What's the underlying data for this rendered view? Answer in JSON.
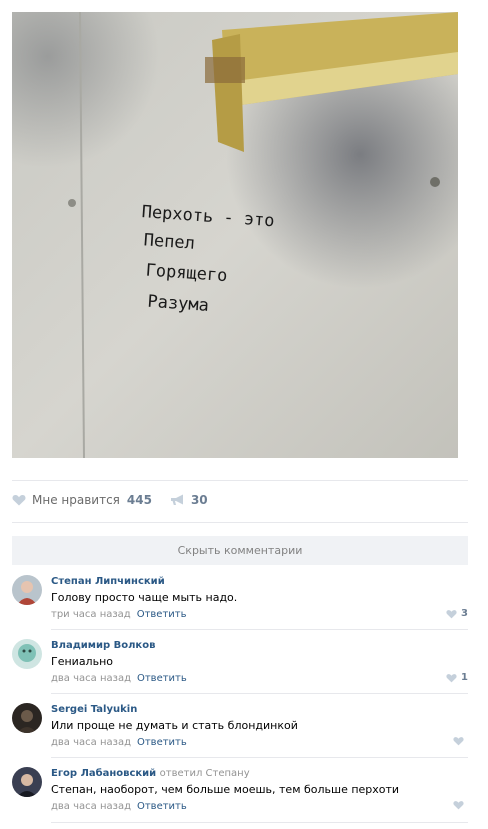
{
  "post": {
    "image_text_lines": [
      "Перхоть - это",
      "Пепел",
      "Горящего",
      "Разума"
    ],
    "likes": {
      "label": "Мне нравится",
      "count": "445"
    },
    "shares": {
      "count": "30"
    }
  },
  "hide_comments_label": "Скрыть комментарии",
  "colors": {
    "link": "#2a5885",
    "muted": "#939393",
    "divider": "#e7e8ec",
    "panel": "#f0f2f5"
  },
  "comments": [
    {
      "author": "Степан Липчинский",
      "replied_to": "",
      "text": "Голову просто чаще мыть надо.",
      "time": "три часа назад",
      "reply_label": "Ответить",
      "likes": "3"
    },
    {
      "author": "Владимир Волков",
      "replied_to": "",
      "text": "Гениально",
      "time": "два часа назад",
      "reply_label": "Ответить",
      "likes": "1"
    },
    {
      "author": "Sergei Talyukin",
      "replied_to": "",
      "text": "Или проще не думать и стать блондинкой",
      "time": "два часа назад",
      "reply_label": "Ответить",
      "likes": ""
    },
    {
      "author": "Егор Лабановский",
      "replied_to": "ответил Степану",
      "text": "Степан, наоборот, чем больше моешь, тем больше перхоти",
      "time": "два часа назад",
      "reply_label": "Ответить",
      "likes": ""
    }
  ]
}
